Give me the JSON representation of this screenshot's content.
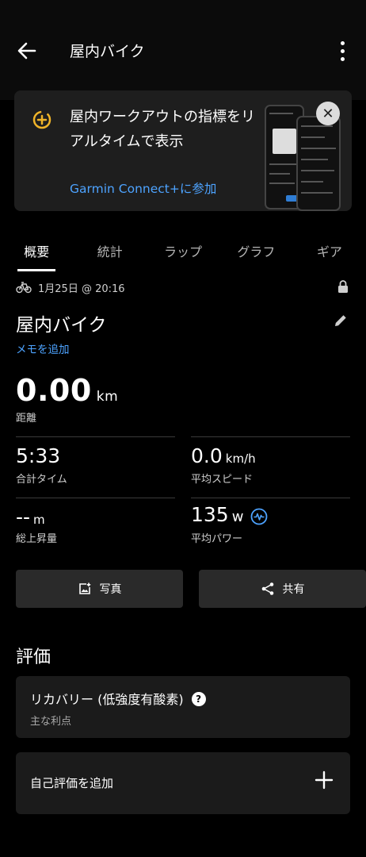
{
  "header": {
    "title": "屋内バイク"
  },
  "promo": {
    "text": "屋内ワークアウトの指標をリアルタイムで表示",
    "link": "Garmin Connect+に参加"
  },
  "tabs": [
    {
      "label": "概要",
      "active": true
    },
    {
      "label": "統計",
      "active": false
    },
    {
      "label": "ラップ",
      "active": false
    },
    {
      "label": "グラフ",
      "active": false
    },
    {
      "label": "ギア",
      "active": false
    }
  ],
  "activity": {
    "date": "1月25日 @ 20:16",
    "title": "屋内バイク",
    "add_note": "メモを追加"
  },
  "stats": {
    "distance": {
      "value": "0.00",
      "unit": "km",
      "label": "距離"
    },
    "total_time": {
      "value": "5:33",
      "label": "合計タイム"
    },
    "avg_speed": {
      "value": "0.0",
      "unit": "km/h",
      "label": "平均スピード"
    },
    "elevation_gain": {
      "value": "--",
      "unit": "m",
      "label": "総上昇量"
    },
    "avg_power": {
      "value": "135",
      "unit": "w",
      "label": "平均パワー"
    }
  },
  "buttons": {
    "photo": "写真",
    "share": "共有"
  },
  "evaluation": {
    "title": "評価",
    "recovery_title": "リカバリー (低強度有酸素)",
    "recovery_sub": "主な利点",
    "self_eval": "自己評価を追加"
  },
  "colors": {
    "accent_link": "#4da3ff",
    "promo_icon": "#f0b429",
    "power_icon": "#4da3ff"
  }
}
